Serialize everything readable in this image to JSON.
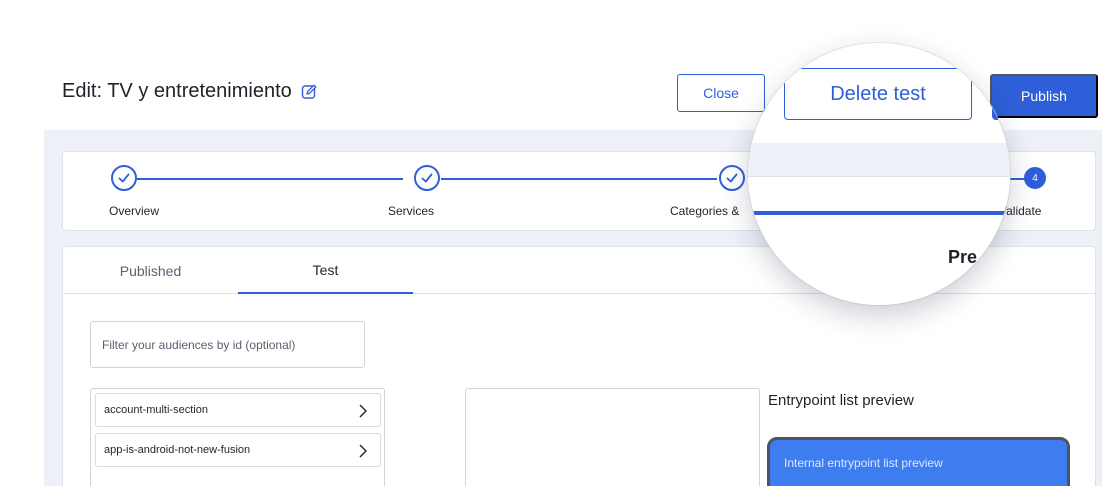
{
  "header": {
    "title": "Edit: TV y entretenimiento",
    "edit_icon": "edit-icon",
    "close_label": "Close",
    "publish_label": "Publish",
    "delete_label": "Delete test"
  },
  "stepper": {
    "steps": [
      {
        "label": "Overview",
        "state": "done"
      },
      {
        "label": "Services",
        "state": "done"
      },
      {
        "label": "Categories &",
        "state": "done"
      },
      {
        "label": "Validate",
        "state": "current",
        "number": "4"
      }
    ]
  },
  "tabs": [
    {
      "label": "Published",
      "active": false
    },
    {
      "label": "Test",
      "active": true
    }
  ],
  "filter": {
    "placeholder": "Filter your audiences by id (optional)",
    "value": ""
  },
  "audiences": [
    {
      "label": "account-multi-section"
    },
    {
      "label": "app-is-android-not-new-fusion"
    }
  ],
  "entrypoint": {
    "title": "Entrypoint list preview",
    "card_label": "Internal entrypoint list preview"
  },
  "magnifier": {
    "partial_text": "Pre"
  },
  "colors": {
    "accent": "#2f5fd8",
    "background": "#edf0f7",
    "card_blue": "#3e7df0"
  }
}
